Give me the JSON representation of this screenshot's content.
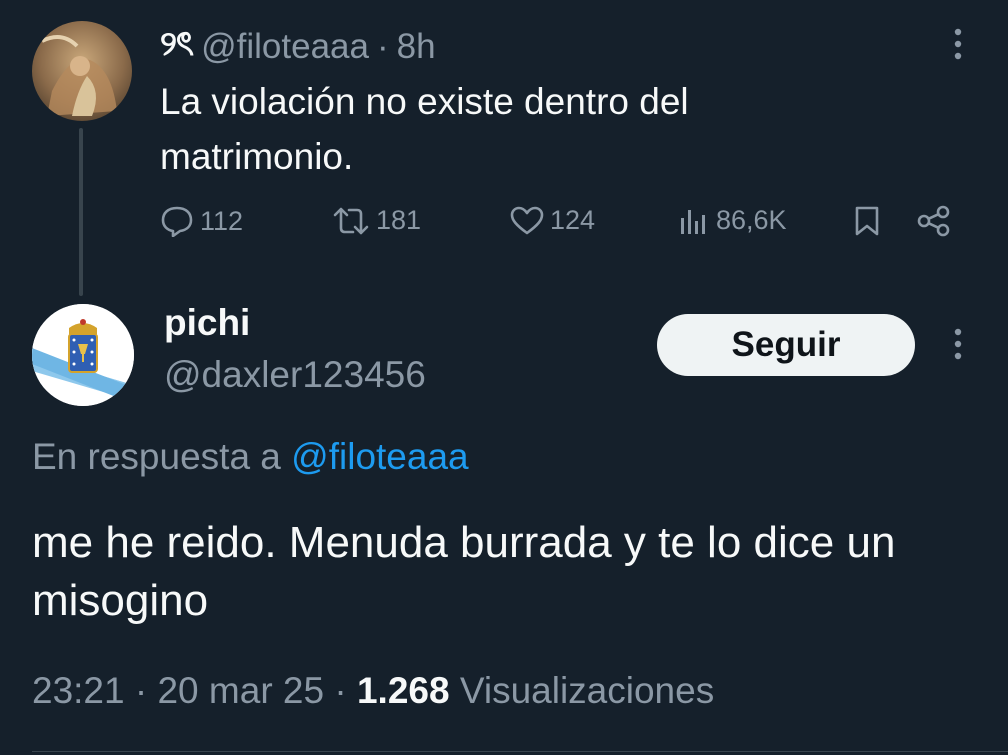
{
  "parent": {
    "display_name": "୨ৎ",
    "handle": "@filoteaaa",
    "separator": "·",
    "time": "8h",
    "text": "La violación no existe dentro del matrimonio.",
    "metrics": {
      "replies": "112",
      "retweets": "181",
      "likes": "124",
      "views": "86,6K"
    }
  },
  "reply": {
    "display_name": "pichi",
    "handle": "@daxler123456",
    "follow_label": "Seguir",
    "in_reply_prefix": "En respuesta a",
    "in_reply_handle": "@filoteaaa",
    "text": "me he reido. Menuda burrada y te lo dice un misogino",
    "meta": {
      "time": "23:21",
      "sep1": "·",
      "date": "20 mar 25",
      "sep2": "·",
      "views_count": "1.268",
      "views_label": "Visualizaciones"
    }
  },
  "colors": {
    "background": "#15202b",
    "text": "#f7f9f9",
    "muted": "#8b98a5",
    "link": "#1d9bf0",
    "button_bg": "#eff3f4"
  }
}
